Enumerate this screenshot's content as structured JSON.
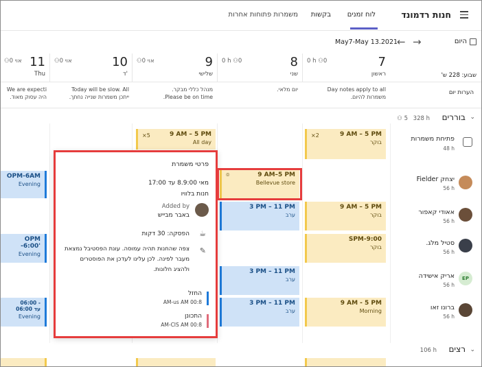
{
  "header": {
    "team_name": "חנות רדמונד",
    "tabs": [
      {
        "label": "לוח זמנים",
        "active": true
      },
      {
        "label": "בקשות"
      },
      {
        "label": "משמרות פתוחות אחרות"
      }
    ]
  },
  "toolbar": {
    "today_label": "היום",
    "date_range": "May7-May 13.2021"
  },
  "week_total": "שבוע: 228 ש'",
  "notes_label": "הערות יום",
  "days": [
    {
      "num": "7",
      "name": "ראשון",
      "stats": "0 h  ⚇0"
    },
    {
      "num": "8",
      "name": "שני",
      "stats": "0 h  ⚇0"
    },
    {
      "num": "9",
      "name": "שלישי",
      "stats": "⚇0  אוי"
    },
    {
      "num": "10",
      "name": "ד'",
      "stats": "⚇0  אוי"
    },
    {
      "num": "11",
      "name": "Thu",
      "stats": "⚇0  אוי"
    }
  ],
  "notes": [
    "Day notes apply to all\nמשמרות להיום.",
    "יום מלאי.",
    "מנהל כללי מבקר.\nPlease be on time.",
    "Today will be slow. All\nייתכן משמרות שנייה נחתך.",
    "We are expecti\nהיה עסוק מאוד."
  ],
  "groups": [
    {
      "name": "בוררים",
      "hours": "328 h",
      "count": "⚇ 5"
    },
    {
      "name": "רצים",
      "hours": "106 h"
    }
  ],
  "open_shifts": {
    "label": "פתיחת משמרות",
    "hours": "48 h"
  },
  "people": [
    {
      "name": "יצחק  Fielder",
      "hours": "56 h"
    },
    {
      "name": "אאודי קאפור",
      "hours": "56 h"
    },
    {
      "name": "סטיל מלג.",
      "hours": "56 h"
    },
    {
      "name": "אריק אישידה",
      "hours": "56 h",
      "initials": "EP"
    },
    {
      "name": "ברונו זאו",
      "hours": "56 h"
    }
  ],
  "shifts": {
    "open_sun": {
      "time": "9 AM – 5 PM",
      "sub": "בוקר",
      "count": "×2"
    },
    "open_tue": {
      "time": "9 AM – 5 PM",
      "sub": "All day",
      "count": "×5"
    },
    "fielder_mon": {
      "time": "9 AM–5 PM",
      "sub": "Bellevue store"
    },
    "fielder_thu": {
      "time": "OPM-6AM",
      "sub": "Evening"
    },
    "kapoor_sun": {
      "time": "9 AM – 5 PM",
      "sub": "בוקר"
    },
    "kapoor_mon": {
      "time": "3 PM – 11 PM",
      "sub": "ערב"
    },
    "mlg_sun": {
      "time": "SPM-9:00",
      "sub": "בוקר"
    },
    "mlg_thu": {
      "time": "OPM -6:00'",
      "sub": "Evening"
    },
    "ishida_mon": {
      "time": "3 PM – 11 PM",
      "sub": "ערב"
    },
    "zao_sun": {
      "time": "9 AM - 5 PM",
      "sub": "Morning"
    },
    "zao_mon": {
      "time": "3 PM – 11 PM",
      "sub": "ערב"
    },
    "zao_thu": {
      "time": "06:00 - 06:00 עד",
      "sub": "Evening"
    }
  },
  "popup": {
    "title": "פרטי משמרת",
    "time": "מאי 8.9:00 עד 17:00",
    "location": "חנות בלוויו",
    "added_by_label": "Added by",
    "added_by_name": "באבר מבייש",
    "break": "הפסקה: 30 דקות",
    "note": "צפה שהחנות תהיה עמוסה. עונת הפסטיבל נמצאת מעבר לפינה. לכן עלינו לעדכן את הפוסטרים ולהציג חלונות.",
    "activities": [
      {
        "name": "החזל",
        "time": "AM-us AM 00:8",
        "color": "#1e7ad9"
      },
      {
        "name": "התכונן",
        "time": "AM-CIS AM 00:8",
        "color": "#e06b7a"
      }
    ]
  },
  "colors": {
    "accent": "#5b5fc7",
    "highlight": "#e63c3c"
  }
}
